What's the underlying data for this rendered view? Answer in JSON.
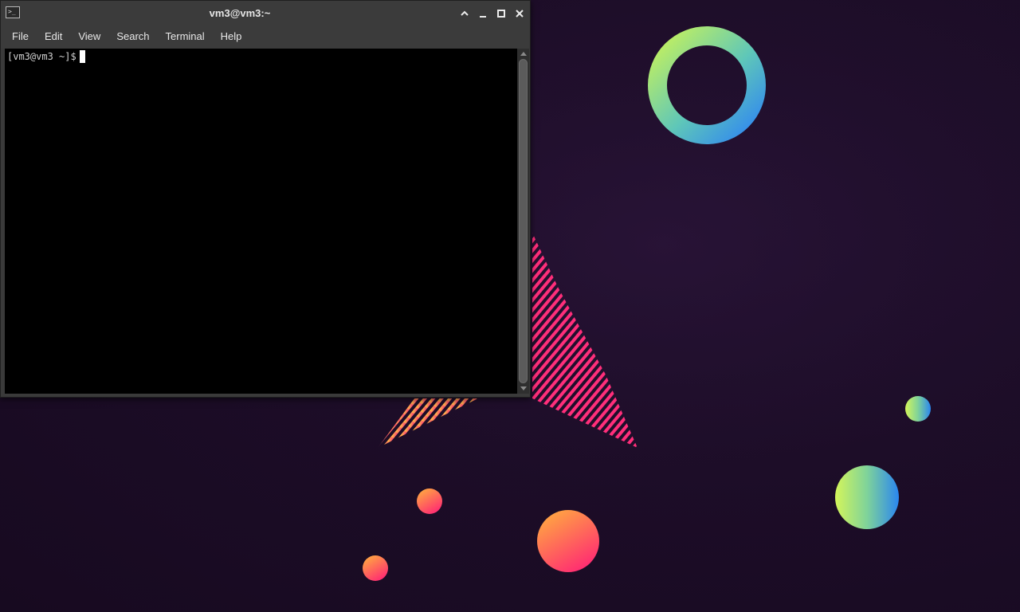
{
  "window": {
    "title": "vm3@vm3:~",
    "app_icon": "terminal-icon"
  },
  "title_buttons": {
    "restore_icon": "chevron-up-icon",
    "minimize_icon": "minimize-icon",
    "maximize_icon": "maximize-icon",
    "close_icon": "close-icon"
  },
  "menubar": {
    "items": [
      {
        "label": "File"
      },
      {
        "label": "Edit"
      },
      {
        "label": "View"
      },
      {
        "label": "Search"
      },
      {
        "label": "Terminal"
      },
      {
        "label": "Help"
      }
    ]
  },
  "terminal": {
    "prompt": "[vm3@vm3 ~]$",
    "background": "#000000",
    "foreground": "#d0d0d0"
  },
  "wallpaper": {
    "background": "#1d0d28",
    "accent_colors": [
      "#c8f25a",
      "#2f8ef0",
      "#ff3f8a",
      "#ffb03a",
      "#ff2e7a"
    ]
  }
}
